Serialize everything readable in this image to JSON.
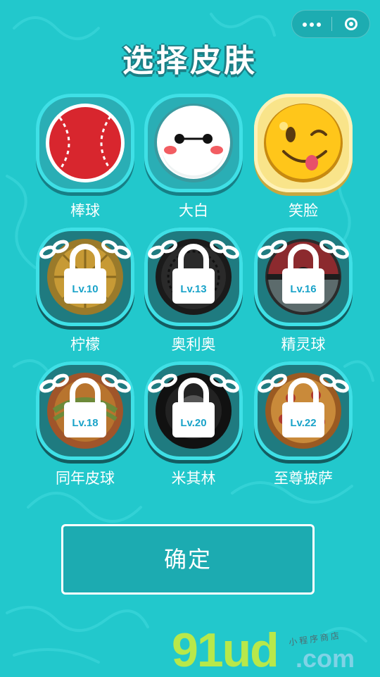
{
  "title": "选择皮肤",
  "capsule": {
    "more_icon": "more-dots-icon",
    "close_icon": "close-circle-icon"
  },
  "skins": [
    {
      "label": "棒球",
      "state": "unlocked",
      "icon": "baseball-icon"
    },
    {
      "label": "大白",
      "state": "unlocked",
      "icon": "baymax-face-icon"
    },
    {
      "label": "笑脸",
      "state": "selected",
      "icon": "wink-smiley-icon"
    },
    {
      "label": "柠檬",
      "state": "locked",
      "level": "Lv.10",
      "icon": "lemon-icon"
    },
    {
      "label": "奥利奥",
      "state": "locked",
      "level": "Lv.13",
      "icon": "oreo-cookie-icon"
    },
    {
      "label": "精灵球",
      "state": "locked",
      "level": "Lv.16",
      "icon": "pokeball-icon"
    },
    {
      "label": "同年皮球",
      "state": "locked",
      "level": "Lv.18",
      "icon": "retro-ball-icon"
    },
    {
      "label": "米其林",
      "state": "locked",
      "level": "Lv.20",
      "icon": "tire-icon"
    },
    {
      "label": "至尊披萨",
      "state": "locked",
      "level": "Lv.22",
      "icon": "pizza-icon"
    }
  ],
  "confirm_label": "确定",
  "watermark": {
    "main": "91ud",
    "domain": ".com",
    "small": "小程序商店"
  },
  "colors": {
    "background": "#22c8cc",
    "frame": "#2aaeb5",
    "selected_frame": "#f9e48a",
    "lock_text": "#1aa3c9"
  }
}
